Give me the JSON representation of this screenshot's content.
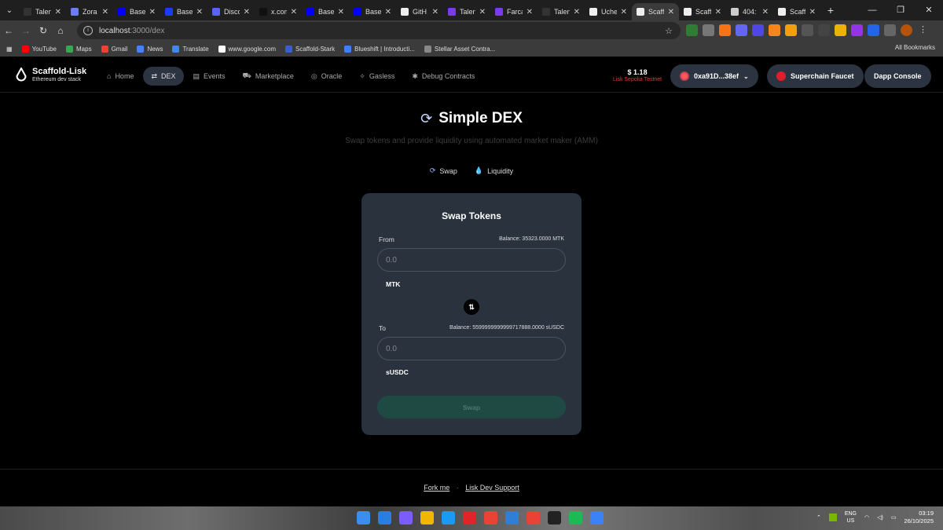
{
  "browser": {
    "tabs": [
      {
        "label": "Talen",
        "color": "#333333",
        "active": false
      },
      {
        "label": "Zora",
        "color": "#6b7cff",
        "active": false
      },
      {
        "label": "Base",
        "color": "#0000ff",
        "active": false
      },
      {
        "label": "Base",
        "color": "#1a3cff",
        "active": false
      },
      {
        "label": "Disco",
        "color": "#5865f2",
        "active": false
      },
      {
        "label": "x.com",
        "color": "#111111",
        "active": false
      },
      {
        "label": "Base",
        "color": "#0000ff",
        "active": false
      },
      {
        "label": "Base",
        "color": "#0000ff",
        "active": false
      },
      {
        "label": "GitH",
        "color": "#eeeeee",
        "active": false
      },
      {
        "label": "Talen",
        "color": "#7c3aed",
        "active": false
      },
      {
        "label": "Farca",
        "color": "#7c3aed",
        "active": false
      },
      {
        "label": "Talen",
        "color": "#333333",
        "active": false
      },
      {
        "label": "Uche",
        "color": "#eeeeee",
        "active": false
      },
      {
        "label": "Scaff",
        "color": "#eeeeee",
        "active": true
      },
      {
        "label": "Scaff",
        "color": "#eeeeee",
        "active": false
      },
      {
        "label": "404:",
        "color": "#cccccc",
        "active": false
      },
      {
        "label": "Scaff",
        "color": "#eeeeee",
        "active": false
      }
    ],
    "url_host": "localhost",
    "url_path": ":3000/dex",
    "bookmarks": [
      {
        "label": "YouTube",
        "color": "#ff0000"
      },
      {
        "label": "Maps",
        "color": "#34a853"
      },
      {
        "label": "Gmail",
        "color": "#ea4335"
      },
      {
        "label": "News",
        "color": "#4285f4"
      },
      {
        "label": "Translate",
        "color": "#4285f4"
      },
      {
        "label": "www.google.com",
        "color": "#ffffff"
      },
      {
        "label": "Scaffold-Stark",
        "color": "#3b5bdb"
      },
      {
        "label": "Blueshift | Introducti...",
        "color": "#3b82f6"
      },
      {
        "label": "Stellar Asset Contra...",
        "color": "#888888"
      }
    ],
    "all_bookmarks": "All Bookmarks"
  },
  "app": {
    "brand_title": "Scaffold-Lisk",
    "brand_sub": "Ethereum dev stack",
    "nav": [
      {
        "label": "Home",
        "icon": "⌂",
        "active": false
      },
      {
        "label": "DEX",
        "icon": "⇄",
        "active": true
      },
      {
        "label": "Events",
        "icon": "▤",
        "active": false
      },
      {
        "label": "Marketplace",
        "icon": "⛟",
        "active": false
      },
      {
        "label": "Oracle",
        "icon": "◎",
        "active": false
      },
      {
        "label": "Gasless",
        "icon": "✧",
        "active": false
      },
      {
        "label": "Debug Contracts",
        "icon": "✱",
        "active": false
      }
    ],
    "balance": "$ 1.18",
    "network": "Lisk Sepolia Testnet",
    "wallet": "0xa91D...38ef",
    "faucet": "Superchain Faucet",
    "console": "Dapp Console"
  },
  "dex": {
    "title": "Simple DEX",
    "subtitle": "Swap tokens and provide liquidity using automated market maker (AMM)",
    "mode_swap": "Swap",
    "mode_liquidity": "Liquidity",
    "card_title": "Swap Tokens",
    "from_label": "From",
    "from_balance": "Balance: 35323.0000 MTK",
    "from_placeholder": "0.0",
    "from_token": "MTK",
    "to_label": "To",
    "to_balance": "Balance: 5599999999999717888.0000 sUSDC",
    "to_placeholder": "0.0",
    "to_token": "sUSDC",
    "flip_icon": "⇅",
    "swap_button": "Swap"
  },
  "footer": {
    "fork": "Fork me",
    "sep": "·",
    "support": "Lisk Dev Support"
  },
  "taskbar": {
    "apps": [
      "#2a7de1",
      "#7b5cff",
      "#f2b600",
      "#1a9af0",
      "#e0242b",
      "#ea4335",
      "#2f7fd6",
      "#ea4335",
      "#222222",
      "#1db954",
      "#3b82f6"
    ],
    "lang_1": "ENG",
    "lang_2": "US",
    "time": "03:19",
    "date": "26/10/2025"
  }
}
